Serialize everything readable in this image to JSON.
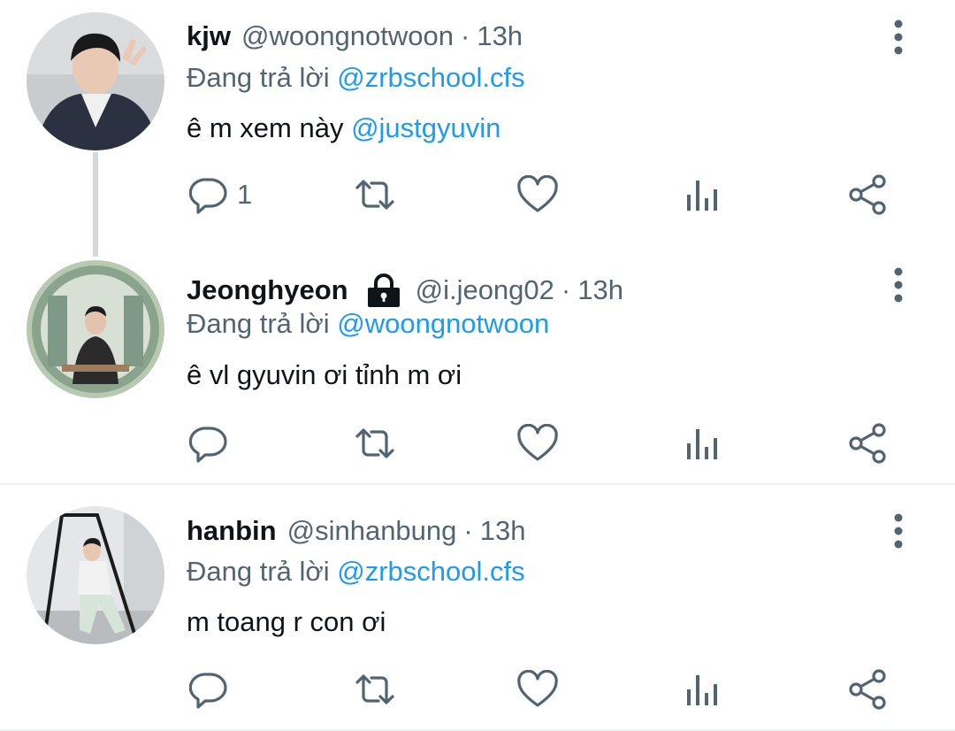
{
  "tweets": [
    {
      "name": "kjw",
      "handle": "@woongnotwoon",
      "separator": "·",
      "time": "13h",
      "replying_prefix": "Đang trả lời",
      "replying_to": "@zrbschool.cfs",
      "text": "ê m xem này",
      "text_mention": "@justgyuvin",
      "reply_count": "1",
      "locked": false
    },
    {
      "name": "Jeonghyeon",
      "handle": "@i.jeong02",
      "separator": "·",
      "time": "13h",
      "replying_prefix": "Đang trả lời",
      "replying_to": "@woongnotwoon",
      "text": "ê vl gyuvin ơi tỉnh m ơi",
      "text_mention": "",
      "reply_count": "",
      "locked": true
    },
    {
      "name": "hanbin",
      "handle": "@sinhanbung",
      "separator": "·",
      "time": "13h",
      "replying_prefix": "Đang trả lời",
      "replying_to": "@zrbschool.cfs",
      "text": "m toang r con ơi",
      "text_mention": "",
      "reply_count": "",
      "locked": false
    }
  ],
  "icons": {
    "reply": "reply-icon",
    "retweet": "retweet-icon",
    "like": "like-icon",
    "views": "views-icon",
    "share": "share-icon",
    "more": "more-vertical-icon",
    "lock": "lock-icon"
  },
  "colors": {
    "text": "#0f1419",
    "secondary": "#536471",
    "accent": "#1d9bf0",
    "thread_line": "#cfd9de",
    "divider": "#eff3f4"
  }
}
